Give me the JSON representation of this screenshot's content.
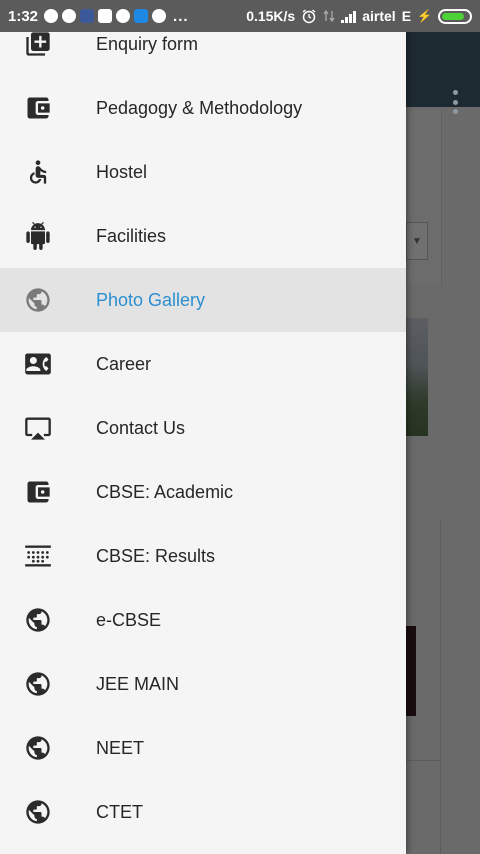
{
  "status_bar": {
    "time": "1:32",
    "more_indicator": "...",
    "speed": "0.15K/s",
    "carrier": "airtel",
    "network_type": "E",
    "battery_level": 0.85,
    "battery_color": "#4cd137"
  },
  "drawer": {
    "accent_color": "#2c8fd1",
    "items": [
      {
        "label": "Enquiry form",
        "icon": "add-box-icon",
        "active": false
      },
      {
        "label": "Pedagogy & Methodology",
        "icon": "wallet-icon",
        "active": false
      },
      {
        "label": "Hostel",
        "icon": "wheelchair-icon",
        "active": false
      },
      {
        "label": "Facilities",
        "icon": "android-icon",
        "active": false
      },
      {
        "label": "Photo Gallery",
        "icon": "globe-icon",
        "active": true
      },
      {
        "label": "Career",
        "icon": "contact-card-icon",
        "active": false
      },
      {
        "label": "Contact Us",
        "icon": "airplay-icon",
        "active": false
      },
      {
        "label": "CBSE: Academic",
        "icon": "wallet-icon",
        "active": false
      },
      {
        "label": "CBSE: Results",
        "icon": "grid-dots-icon",
        "active": false
      },
      {
        "label": "e-CBSE",
        "icon": "globe-icon",
        "active": false
      },
      {
        "label": "JEE MAIN",
        "icon": "globe-icon",
        "active": false
      },
      {
        "label": "NEET",
        "icon": "globe-icon",
        "active": false
      },
      {
        "label": "CTET",
        "icon": "globe-icon",
        "active": false
      }
    ]
  }
}
